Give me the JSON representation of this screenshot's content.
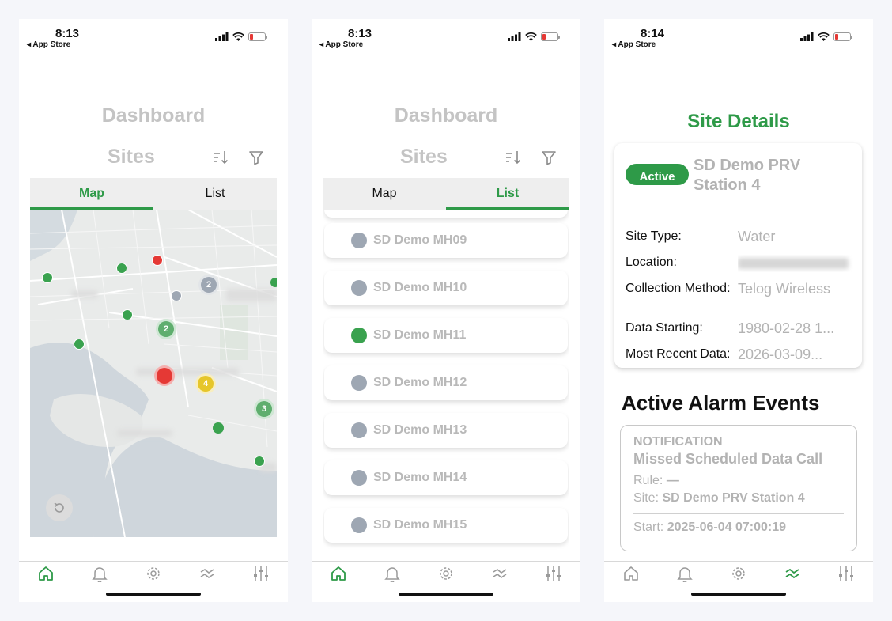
{
  "screens": [
    {
      "status": {
        "time": "8:13",
        "back": "◂ App Store"
      },
      "title": "Dashboard",
      "subtitle": "Sites",
      "tabs": [
        {
          "label": "Map",
          "active": true
        },
        {
          "label": "List",
          "active": false
        }
      ],
      "map_clusters": [
        "2",
        "2",
        "4",
        "3"
      ]
    },
    {
      "status": {
        "time": "8:13",
        "back": "◂ App Store"
      },
      "title": "Dashboard",
      "subtitle": "Sites",
      "tabs": [
        {
          "label": "Map",
          "active": false
        },
        {
          "label": "List",
          "active": true
        }
      ],
      "sites": [
        {
          "name": "SD Demo MH09",
          "status_color": "#9ea7b3"
        },
        {
          "name": "SD Demo MH10",
          "status_color": "#9ea7b3"
        },
        {
          "name": "SD Demo MH11",
          "status_color": "#3aa24f"
        },
        {
          "name": "SD Demo MH12",
          "status_color": "#9ea7b3"
        },
        {
          "name": "SD Demo MH13",
          "status_color": "#9ea7b3"
        },
        {
          "name": "SD Demo MH14",
          "status_color": "#9ea7b3"
        },
        {
          "name": "SD Demo MH15",
          "status_color": "#9ea7b3"
        }
      ]
    },
    {
      "status": {
        "time": "8:14",
        "back": "◂ App Store"
      },
      "title": "Site Details",
      "badge": "Active",
      "site_name": "SD Demo PRV Station 4",
      "details": {
        "site_type_label": "Site Type:",
        "site_type": "Water",
        "location_label": "Location:",
        "collection_label": "Collection Method:",
        "collection": "Telog Wireless",
        "start_label": "Data Starting:",
        "start": "1980-02-28 1...",
        "recent_label": "Most Recent Data:",
        "recent": "2026-03-09..."
      },
      "alarm_section_title": "Active Alarm Events",
      "alarm": {
        "type": "NOTIFICATION",
        "description": "Missed Scheduled Data Call",
        "rule_label": "Rule:",
        "rule": "—",
        "site_label": "Site:",
        "site": "SD Demo PRV Station 4",
        "start_label": "Start:",
        "start": "2025-06-04 07:00:19"
      }
    }
  ],
  "colors": {
    "accent": "#2e9a48",
    "muted": "#c4c4c4",
    "alarm_red": "#e53935",
    "warning_yellow": "#e6c62a",
    "inactive_gray": "#9ea7b3"
  },
  "nav_icons": [
    "home-icon",
    "bell-icon",
    "gear-icon",
    "trend-icon",
    "sliders-icon"
  ]
}
